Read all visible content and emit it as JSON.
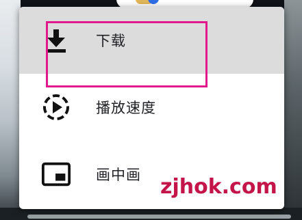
{
  "menu": {
    "items": [
      {
        "label": "下载",
        "icon": "download-icon",
        "selected": true
      },
      {
        "label": "播放速度",
        "icon": "playback-speed-icon",
        "selected": false
      },
      {
        "label": "画中画",
        "icon": "picture-in-picture-icon",
        "selected": false
      }
    ]
  },
  "watermark": {
    "text": "zjhok.com"
  },
  "colors": {
    "highlight_border": "#e0188c",
    "selected_bg": "#dcdcdc",
    "watermark": "#c4154a"
  }
}
